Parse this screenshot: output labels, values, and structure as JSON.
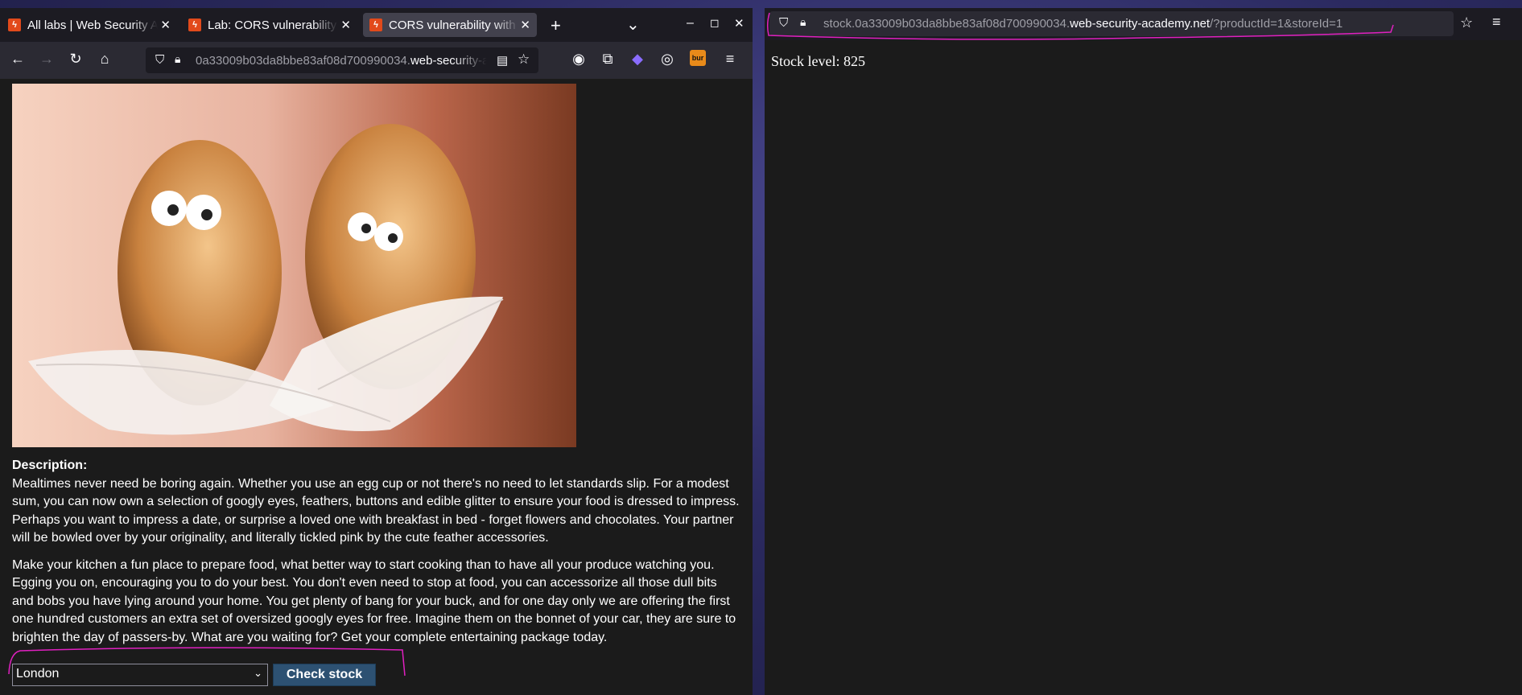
{
  "left_window": {
    "tabs": [
      {
        "title": "All labs | Web Security Academy",
        "active": false
      },
      {
        "title": "Lab: CORS vulnerability with trusted insecure protocols",
        "active": false
      },
      {
        "title": "CORS vulnerability with trusted insecure protocols",
        "active": true
      }
    ],
    "window_controls": {
      "minimize": "–",
      "maximize": "◻",
      "close": "✕"
    },
    "new_tab": "+",
    "tab_list": "⌄",
    "url": {
      "host_dim": "0a33009b03da8bbe83af08d700990034.",
      "host_main": "web-security-academy.net"
    },
    "extensions": {
      "burp": "bur"
    },
    "product": {
      "description_label": "Description:",
      "paragraph1": "Mealtimes never need be boring again. Whether you use an egg cup or not there's no need to let standards slip. For a modest sum, you can now own a selection of googly eyes, feathers, buttons and edible glitter to ensure your food is dressed to impress. Perhaps you want to impress a date, or surprise a loved one with breakfast in bed - forget flowers and chocolates. Your partner will be bowled over by your originality, and literally tickled pink by the cute feather accessories.",
      "paragraph2": "Make your kitchen a fun place to prepare food, what better way to start cooking than to have all your produce watching you. Egging you on, encouraging you to do your best. You don't even need to stop at food, you can accessorize all those dull bits and bobs you have lying around your home. You get plenty of bang for your buck, and for one day only we are offering the first one hundred customers an extra set of oversized googly eyes for free. Imagine them on the bonnet of your car, they are sure to brighten the day of passers-by. What are you waiting for? Get your complete entertaining package today.",
      "store_selected": "London",
      "check_stock_label": "Check stock"
    }
  },
  "right_window": {
    "url": {
      "prefix_dim": "stock.0a33009b03da8bbe83af08d700990034.",
      "host_main": "web-security-academy.net",
      "suffix_dim": "/?productId=1&storeId=1"
    },
    "stock_text": "Stock level: 825"
  },
  "colors": {
    "annotation": "#e020c0",
    "button": "#2d5172",
    "tab_active": "#42414d"
  }
}
